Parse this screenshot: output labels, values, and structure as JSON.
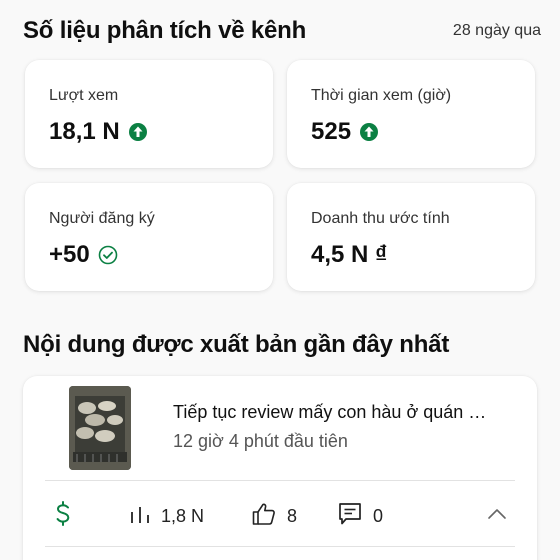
{
  "header": {
    "title": "Số liệu phân tích về kênh",
    "period": "28 ngày qua"
  },
  "metrics": [
    {
      "label": "Lượt xem",
      "value": "18,1 N",
      "icon": "arrow-up-circle-icon",
      "icon_color": "#0b8043"
    },
    {
      "label": "Thời gian xem (giờ)",
      "value": "525",
      "icon": "arrow-up-circle-icon",
      "icon_color": "#0b8043"
    },
    {
      "label": "Người đăng ký",
      "value": "+50",
      "icon": "check-circle-icon",
      "icon_color": "#0b8043"
    },
    {
      "label": "Doanh thu ước tính",
      "value": "4,5 N ₫",
      "icon": "",
      "icon_color": ""
    }
  ],
  "recent": {
    "title": "Nội dung được xuất bản gần đây nhất",
    "video": {
      "title": "Tiếp tục review mấy con hàu ở quán …",
      "subtitle": "12 giờ 4 phút đầu tiên"
    },
    "stats": {
      "revenue_icon": "dollar-icon",
      "revenue_color": "#0b8043",
      "views": "1,8 N",
      "likes": "8",
      "comments": "0"
    }
  }
}
